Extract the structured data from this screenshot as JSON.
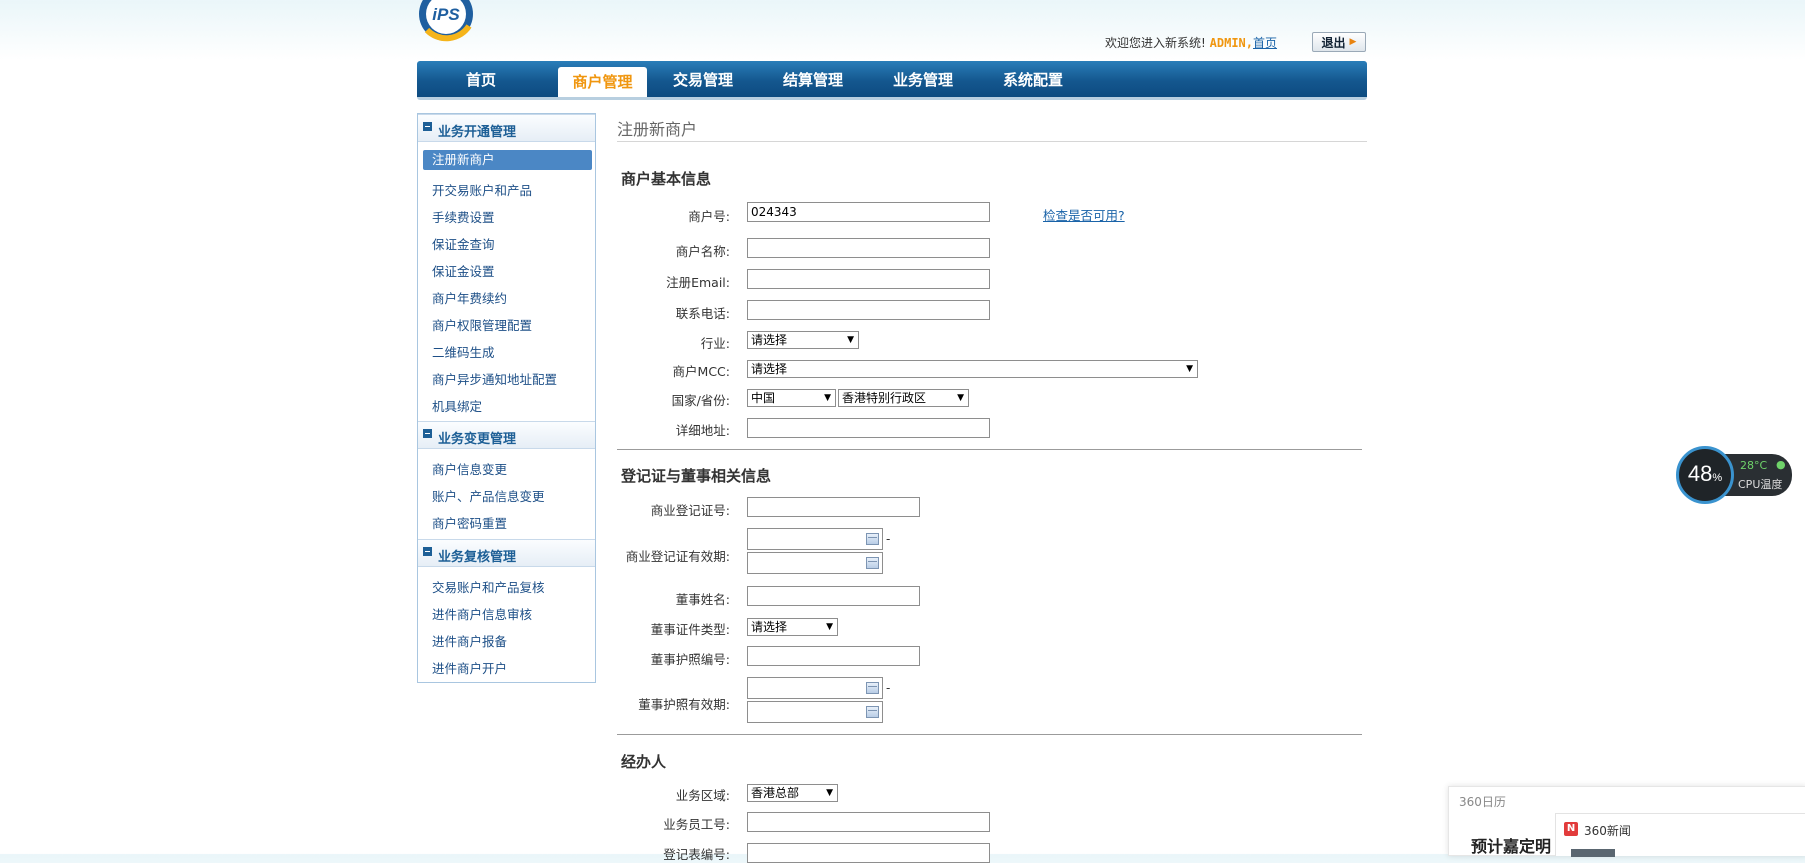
{
  "header": {
    "logo_text": "iPS",
    "welcome_text": "欢迎您进入新系统!",
    "user": "ADMIN,",
    "home_link": "首页",
    "logout_label": "退出"
  },
  "nav": {
    "items": [
      "首页",
      "商户管理",
      "交易管理",
      "结算管理",
      "业务管理",
      "系统配置"
    ],
    "active": "商户管理"
  },
  "sidebar": {
    "sections": [
      {
        "title": "业务开通管理",
        "items": [
          "注册新商户",
          "开交易账户和产品",
          "手续费设置",
          "保证金查询",
          "保证金设置",
          "商户年费续约",
          "商户权限管理配置",
          "二维码生成",
          "商户异步通知地址配置",
          "机具绑定"
        ]
      },
      {
        "title": "业务变更管理",
        "items": [
          "商户信息变更",
          "账户、产品信息变更",
          "商户密码重置"
        ]
      },
      {
        "title": "业务复核管理",
        "items": [
          "交易账户和产品复核",
          "进件商户信息审核",
          "进件商户报备",
          "进件商户开户"
        ]
      }
    ]
  },
  "main": {
    "page_title": "注册新商户",
    "basic": {
      "title": "商户基本信息",
      "merchant_no_label": "商户号:",
      "merchant_no_value": "024343",
      "check_link": "检查是否可用?",
      "name_label": "商户名称:",
      "email_label": "注册Email:",
      "phone_label": "联系电话:",
      "industry_label": "行业:",
      "industry_value": "请选择",
      "mcc_label": "商户MCC:",
      "mcc_value": "请选择",
      "country_label": "国家/省份:",
      "country_value": "中国",
      "province_value": "香港特别行政区",
      "address_label": "详细地址:"
    },
    "registration": {
      "title": "登记证与董事相关信息",
      "reg_no_label": "商业登记证号:",
      "reg_valid_label": "商业登记证有效期:",
      "director_name_label": "董事姓名:",
      "director_id_type_label": "董事证件类型:",
      "director_id_type_value": "请选择",
      "passport_no_label": "董事护照编号:",
      "passport_valid_label": "董事护照有效期:",
      "dash": "-"
    },
    "handler": {
      "title": "经办人",
      "region_label": "业务区域:",
      "region_value": "香港总部",
      "staff_no_label": "业务员工号:",
      "register_no_label": "登记表编号:"
    }
  },
  "widgets": {
    "cpu_percent": "48",
    "cpu_percent_unit": "%",
    "cpu_temp": "28°C",
    "cpu_label": "CPU温度",
    "calendar_title": "360日历",
    "news_source": "360新闻",
    "news_icon": "N",
    "news_headline": "预计嘉定明"
  },
  "colors": {
    "nav_blue": "#14578f",
    "accent_orange": "#f0960f",
    "link_blue": "#1a63a8",
    "sidebar_active": "#4b87c5"
  }
}
